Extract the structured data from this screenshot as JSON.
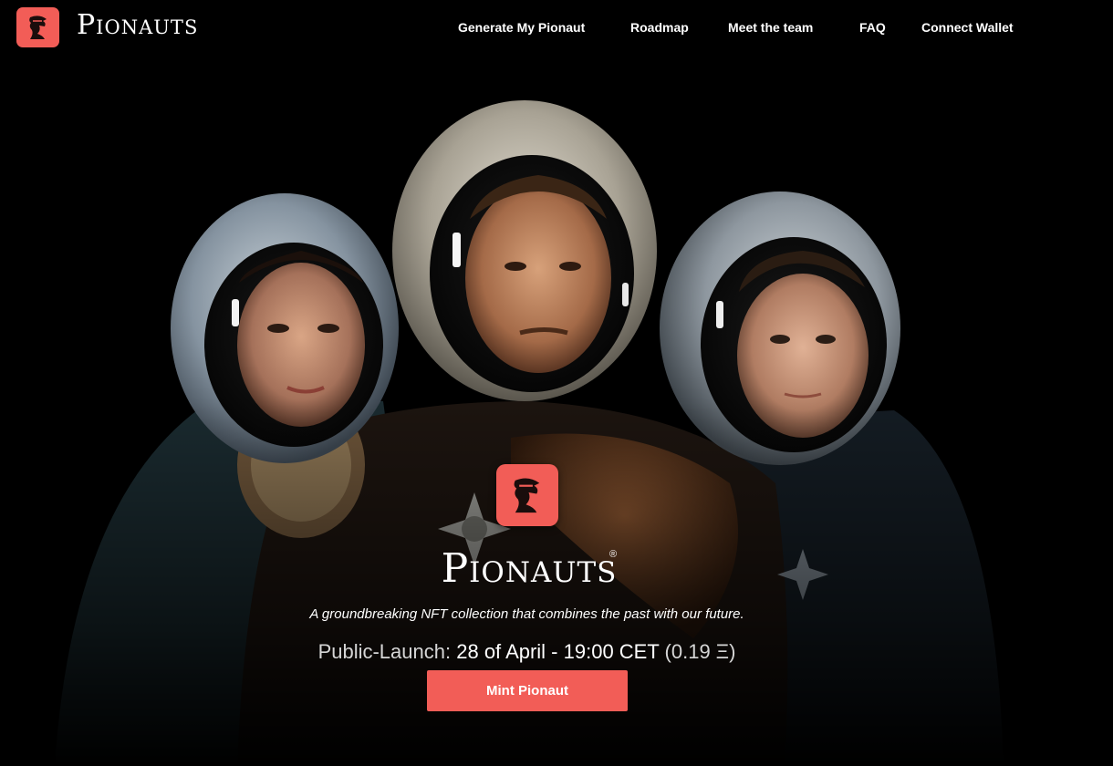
{
  "header": {
    "brand_name": "Pionauts",
    "logo_icon": "pioneer-profile-icon"
  },
  "nav": {
    "items": [
      {
        "label": "Generate My Pionaut"
      },
      {
        "label": "Roadmap"
      },
      {
        "label": "Meet the team"
      },
      {
        "label": "FAQ"
      },
      {
        "label": "Connect Wallet"
      }
    ]
  },
  "hero": {
    "title": "Pionauts",
    "registered_mark": "®",
    "tagline": "A groundbreaking NFT collection that combines the past with our future.",
    "launch_label": "Public-Launch:",
    "launch_date": "28 of April - 19:00 CET",
    "launch_price": "(0.19 Ξ)",
    "mint_button_label": "Mint Pionaut",
    "image_description_icon": "three-astronauts-portrait"
  },
  "colors": {
    "accent": "#f25d57",
    "background": "#000000",
    "text": "#ffffff"
  }
}
